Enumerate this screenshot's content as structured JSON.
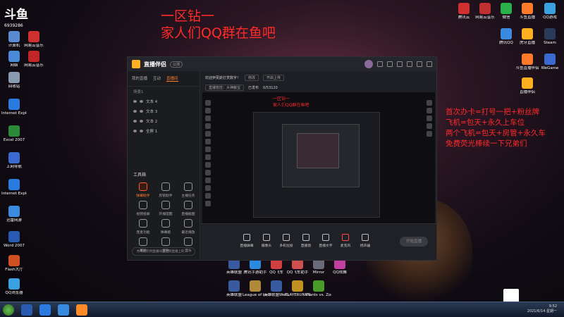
{
  "overlay": {
    "line1": "一区钻一",
    "line2": "家人们QQ群在鱼吧",
    "right_notes": [
      "首次办卡=打号一把+粉丝牌",
      "飞机=包天+永久上车位",
      "两个飞机=包天+房管+永久车",
      "免费荧光棒续一下兄弟们"
    ]
  },
  "streamer_logo": {
    "text": "斗鱼",
    "sub": "6939286"
  },
  "desktop_left": [
    {
      "label": "计算机",
      "color": "#5a8ad0"
    },
    {
      "label": "网易云音乐",
      "color": "#d03030"
    },
    {
      "label": "网络",
      "color": "#4a8ad8"
    },
    {
      "label": "网易云音乐",
      "color": "#c02828"
    },
    {
      "label": "回收站",
      "color": "#8a9ab0"
    },
    {
      "label": "Internet Explorer",
      "color": "#2a7ae0"
    },
    {
      "label": "Excel 2007",
      "color": "#2a8a3a"
    },
    {
      "label": "上网导航",
      "color": "#3a6ad0"
    },
    {
      "label": "Internet Explorer",
      "color": "#2a7ae0"
    },
    {
      "label": "迅雷网游",
      "color": "#3a8ae0"
    },
    {
      "label": "Word 2007",
      "color": "#2a5ab0"
    },
    {
      "label": "Flash大厅",
      "color": "#d05020"
    },
    {
      "label": "QQ浏览器",
      "color": "#3aa0e0"
    }
  ],
  "desktop_right": [
    {
      "label": "腾讯云",
      "color": "#d03030"
    },
    {
      "label": "网易云音乐",
      "color": "#c03030"
    },
    {
      "label": "微信",
      "color": "#2ab04a"
    },
    {
      "label": "斗鱼直播",
      "color": "#ff7a2a"
    },
    {
      "label": "QQ游戏",
      "color": "#3aa0e0"
    },
    {
      "label": "腾讯QQ",
      "color": "#3a8ae0"
    },
    {
      "label": "虎牙直播",
      "color": "#ffb020"
    },
    {
      "label": "Steam",
      "color": "#2a3a5a"
    },
    {
      "label": "斗鱼直播伴侣",
      "color": "#ff7a2a"
    },
    {
      "label": "WeGame",
      "color": "#3a6ad0"
    },
    {
      "label": "直播伴侣",
      "color": "#ffb020"
    }
  ],
  "desktop_bottom": [
    {
      "label": "英雄联盟",
      "color": "#3a5aa0"
    },
    {
      "label": "腾讯手游助手",
      "color": "#2a8ae0"
    },
    {
      "label": "QQ飞车",
      "color": "#d04040"
    },
    {
      "label": "QQ飞车助手",
      "color": "#d05050"
    },
    {
      "label": "Mirror",
      "color": "#6a6a7a"
    },
    {
      "label": "QQ炫舞",
      "color": "#c040a0"
    },
    {
      "label": "英雄联盟",
      "color": "#3a5aa0"
    },
    {
      "label": "League of Legends",
      "color": "#b08a3a"
    },
    {
      "label": "英雄联盟WeGame版",
      "color": "#3a5aa0"
    },
    {
      "label": "PLAYERUNKNOWN'S BATTLEGROUNDS",
      "color": "#c09020"
    },
    {
      "label": "Plants vs. Zombies G...",
      "color": "#4a9a2a"
    }
  ],
  "app": {
    "name": "直播伴侣",
    "version": "公测",
    "side_tabs": [
      "我的直播",
      "互动",
      "直播间"
    ],
    "scene_header": "场景1",
    "scenes": [
      "文本 4",
      "文本 3",
      "文本 2",
      "全屏 1"
    ],
    "tools_title": "工具箱",
    "tools": [
      "弹幕助手",
      "房管助手",
      "主播任务",
      "视频投屏",
      "开播提醒",
      "直播截图",
      "连麦功能",
      "弹幕姬",
      "最近播放",
      "美颜",
      "音效",
      "音乐"
    ],
    "side_bottom": "你可把示例直播间送回到直播上的…",
    "top_line": "欢迎伊芙斯打赏数字！",
    "top_btn1": "修改",
    "top_btn2": "开启上传",
    "top_line2": "直播管控：大神献宝",
    "top_line3": "已发布",
    "top_stats": "0/53120",
    "preview_red1": "一区钻一",
    "preview_red2": "家人们QQ群在鱼吧",
    "controls": [
      "直播屏幕",
      "摄像头",
      "多机位投",
      "直播窗",
      "直播文字",
      "麦克风",
      "扬声器"
    ],
    "start_live": "开始直播"
  },
  "taskbar": {
    "time": "9:52",
    "date": "2021/6/14 星期一"
  }
}
